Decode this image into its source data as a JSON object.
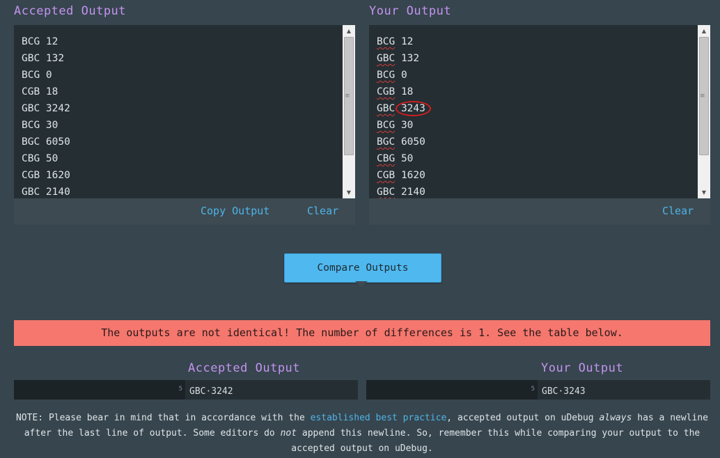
{
  "accepted_panel": {
    "heading": "Accepted Output",
    "lines": [
      "BCG 12",
      "GBC 132",
      "BCG 0",
      "CGB 18",
      "GBC 3242",
      "BCG 30",
      "BGC 6050",
      "CBG 50",
      "CGB 1620",
      "GBC 2140"
    ],
    "copy_label": "Copy Output",
    "clear_label": "Clear"
  },
  "your_panel": {
    "heading": "Your Output",
    "lines": [
      {
        "code": "BCG",
        "value": "12"
      },
      {
        "code": "GBC",
        "value": "132"
      },
      {
        "code": "BCG",
        "value": "0"
      },
      {
        "code": "CGB",
        "value": "18"
      },
      {
        "code": "GBC",
        "value": "3243"
      },
      {
        "code": "BCG",
        "value": "30"
      },
      {
        "code": "BGC",
        "value": "6050"
      },
      {
        "code": "CBG",
        "value": "50"
      },
      {
        "code": "CGB",
        "value": "1620"
      },
      {
        "code": "GBC",
        "value": "2140"
      }
    ],
    "clear_label": "Clear"
  },
  "compare_button": "Compare Outputs",
  "alert": "The outputs are not identical! The number of differences is 1. See the table below.",
  "diff_table": {
    "accepted_heading": "Accepted Output",
    "your_heading": "Your Output",
    "rows": [
      {
        "line": "5",
        "accepted": "GBC·3242",
        "yours": "GBC·3243"
      }
    ]
  },
  "note": {
    "prefix": "NOTE: Please bear in mind that in accordance with the ",
    "link": "established best practice",
    "mid1": ", accepted output on uDebug ",
    "em1": "always",
    "mid2": " has a newline after the last line of output. Some editors do ",
    "em2": "not",
    "suffix": " append this newline. So, remember this while comparing your output to the accepted output on uDebug."
  },
  "colors": {
    "background": "#37454e",
    "heading": "#c394ef",
    "link": "#4fb4e6",
    "button": "#4fb8ef",
    "alert": "#f5776e",
    "highlight_circle": "#d21f1f"
  }
}
